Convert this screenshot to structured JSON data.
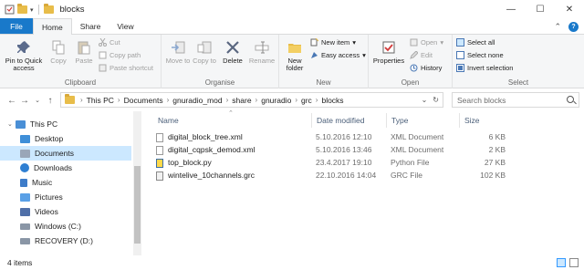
{
  "window": {
    "title": "blocks"
  },
  "tabs": [
    {
      "label": "File"
    },
    {
      "label": "Home"
    },
    {
      "label": "Share"
    },
    {
      "label": "View"
    }
  ],
  "ribbon": {
    "clipboard": {
      "label": "Clipboard",
      "pin": "Pin to Quick access",
      "copy": "Copy",
      "paste": "Paste",
      "cut": "Cut",
      "copy_path": "Copy path",
      "paste_shortcut": "Paste shortcut"
    },
    "organise": {
      "label": "Organise",
      "move_to": "Move to",
      "copy_to": "Copy to",
      "delete": "Delete",
      "rename": "Rename"
    },
    "new": {
      "label": "New",
      "new_folder": "New folder",
      "new_item": "New item",
      "easy_access": "Easy access"
    },
    "open": {
      "label": "Open",
      "properties": "Properties",
      "open": "Open",
      "edit": "Edit",
      "history": "History"
    },
    "select": {
      "label": "Select",
      "select_all": "Select all",
      "select_none": "Select none",
      "invert_selection": "Invert selection"
    }
  },
  "address": {
    "crumbs": [
      "This PC",
      "Documents",
      "gnuradio_mod",
      "share",
      "gnuradio",
      "grc",
      "blocks"
    ],
    "search_placeholder": "Search blocks"
  },
  "nav": {
    "items": [
      {
        "label": "This PC",
        "icon": "pc-icon",
        "selected": false
      },
      {
        "label": "Desktop",
        "icon": "desktop-icon",
        "selected": false
      },
      {
        "label": "Documents",
        "icon": "documents-icon",
        "selected": true
      },
      {
        "label": "Downloads",
        "icon": "downloads-icon",
        "selected": false
      },
      {
        "label": "Music",
        "icon": "music-icon",
        "selected": false
      },
      {
        "label": "Pictures",
        "icon": "pictures-icon",
        "selected": false
      },
      {
        "label": "Videos",
        "icon": "videos-icon",
        "selected": false
      },
      {
        "label": "Windows (C:)",
        "icon": "drive-icon",
        "selected": false
      },
      {
        "label": "RECOVERY (D:)",
        "icon": "drive-icon",
        "selected": false
      }
    ]
  },
  "files": {
    "columns": {
      "name": "Name",
      "date": "Date modified",
      "type": "Type",
      "size": "Size"
    },
    "rows": [
      {
        "name": "digital_block_tree.xml",
        "date": "5.10.2016 12:10",
        "type": "XML Document",
        "size": "6 KB",
        "icon": "xml-file-icon"
      },
      {
        "name": "digital_cqpsk_demod.xml",
        "date": "5.10.2016 13:46",
        "type": "XML Document",
        "size": "2 KB",
        "icon": "xml-file-icon"
      },
      {
        "name": "top_block.py",
        "date": "23.4.2017 19:10",
        "type": "Python File",
        "size": "27 KB",
        "icon": "python-file-icon"
      },
      {
        "name": "wintelive_10channels.grc",
        "date": "22.10.2016 14:04",
        "type": "GRC File",
        "size": "102 KB",
        "icon": "grc-file-icon"
      }
    ]
  },
  "status": {
    "count": "4 items"
  },
  "colors": {
    "accent": "#1979ca",
    "selection": "#cce8ff",
    "folder": "#e8bd4a"
  }
}
